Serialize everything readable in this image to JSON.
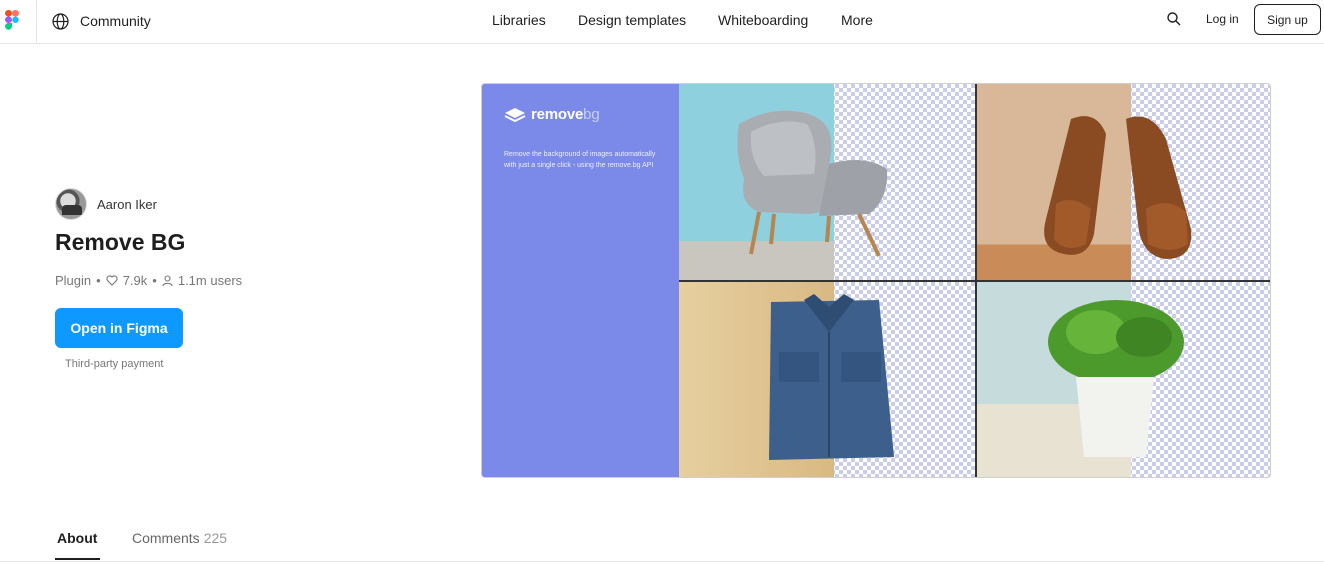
{
  "header": {
    "section_label": "Community",
    "nav": [
      "Libraries",
      "Design templates",
      "Whiteboarding",
      "More"
    ],
    "login_label": "Log in",
    "signup_label": "Sign up"
  },
  "plugin": {
    "author": "Aaron Iker",
    "title": "Remove BG",
    "type": "Plugin",
    "likes": "7.9k",
    "users": "1.1m users",
    "open_label": "Open in Figma",
    "payment_note": "Third-party payment"
  },
  "hero": {
    "logo_main": "remove",
    "logo_accent": "bg",
    "description": "Remove the background of images automatically with just a single click - using the remove.bg API",
    "accent_color": "#7b89e8"
  },
  "tabs": {
    "about": "About",
    "comments": "Comments",
    "comments_count": "225"
  },
  "colors": {
    "primary_button": "#0d99ff",
    "text": "#1e1e1e"
  }
}
